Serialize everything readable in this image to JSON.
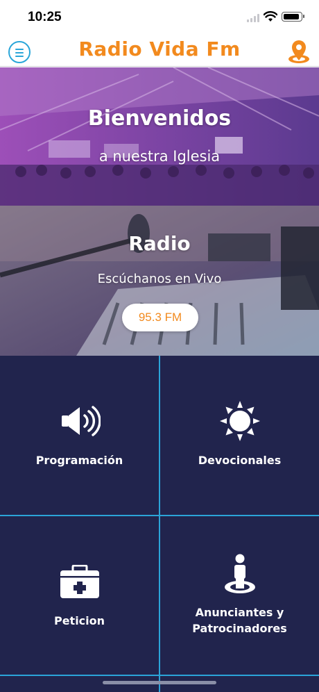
{
  "status_bar": {
    "time": "10:25"
  },
  "nav": {
    "title": "Radio Vida Fm"
  },
  "banners": {
    "church": {
      "title": "Bienvenidos",
      "subtitle": "a nuestra Iglesia"
    },
    "radio": {
      "title": "Radio",
      "subtitle": "Escúchanos en Vivo",
      "frequency_button": "95.3 FM"
    }
  },
  "grid": {
    "items": [
      {
        "label": "Programación",
        "icon": "speaker-icon"
      },
      {
        "label": "Devocionales",
        "icon": "sun-icon"
      },
      {
        "label": "Peticion",
        "icon": "first-aid-kit-icon"
      },
      {
        "label_line1": "Anunciantes y",
        "label_line2": "Patrocinadores",
        "icon": "person-pedestal-icon"
      }
    ]
  },
  "colors": {
    "brand_orange": "#f28a1e",
    "accent_blue": "#2aa6d9",
    "grid_background": "#21244d"
  }
}
